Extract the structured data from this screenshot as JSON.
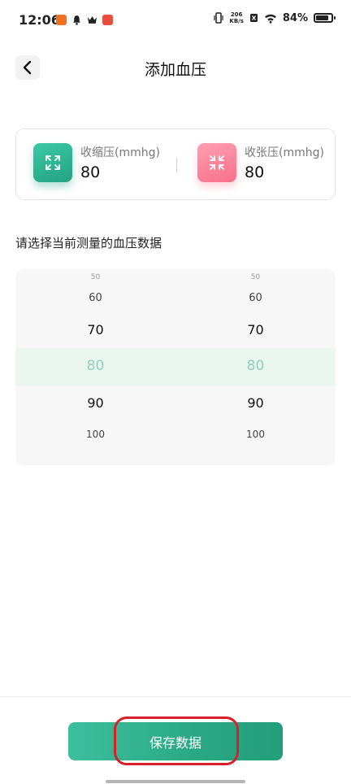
{
  "status_bar": {
    "time": "12:06",
    "net_speed_value": "206",
    "net_speed_unit": "KB/s",
    "battery": "84%"
  },
  "header": {
    "title": "添加血压"
  },
  "pressure": {
    "systolic_label": "收缩压(mmhg)",
    "systolic_value": "80",
    "diastolic_label": "收张压(mmhg)",
    "diastolic_value": "80"
  },
  "section": {
    "label": "请选择当前测量的血压数据"
  },
  "picker": {
    "left": [
      "50",
      "60",
      "70",
      "80",
      "90",
      "100"
    ],
    "right": [
      "50",
      "60",
      "70",
      "80",
      "90",
      "100"
    ]
  },
  "footer": {
    "save_label": "保存数据"
  }
}
